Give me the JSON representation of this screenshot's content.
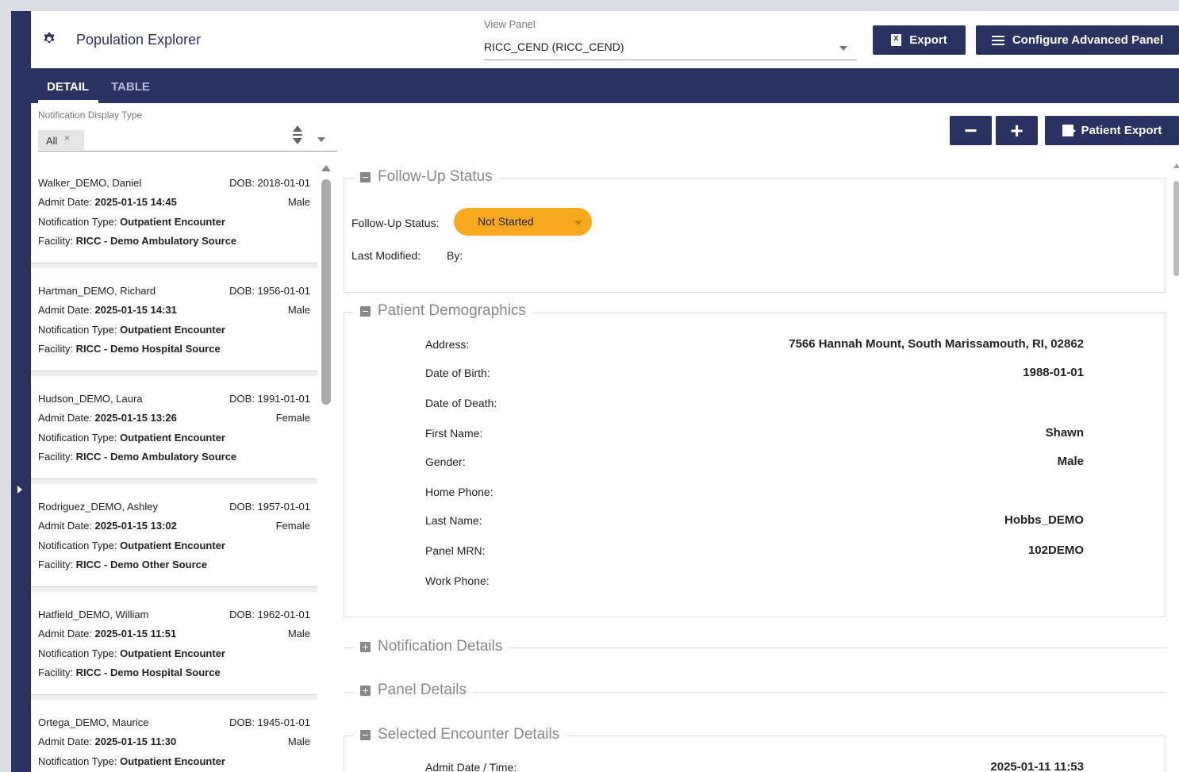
{
  "header": {
    "app_title": "Population Explorer",
    "view_panel_label": "View Panel",
    "view_panel_value": "RICC_CEND (RICC_CEND)",
    "export_label": "Export",
    "configure_label": "Configure Advanced Panel"
  },
  "tabs": [
    {
      "label": "DETAIL",
      "active": true
    },
    {
      "label": "TABLE",
      "active": false
    }
  ],
  "filter": {
    "label": "Notification Display Type",
    "chip": "All",
    "chip_remove": "×"
  },
  "actions": {
    "minus": "−",
    "plus": "+",
    "patient_export": "Patient Export"
  },
  "patients": [
    {
      "name": "Walker_DEMO, Daniel",
      "dob": "DOB: 2018-01-01",
      "admit_label": "Admit Date: ",
      "admit": "2025-01-15 14:45",
      "sex": "Male",
      "ntype_label": "Notification Type: ",
      "ntype": "Outpatient Encounter",
      "facility_label": "Facility: ",
      "facility": "RICC - Demo Ambulatory Source"
    },
    {
      "name": "Hartman_DEMO, Richard",
      "dob": "DOB: 1956-01-01",
      "admit_label": "Admit Date: ",
      "admit": "2025-01-15 14:31",
      "sex": "Male",
      "ntype_label": "Notification Type: ",
      "ntype": "Outpatient Encounter",
      "facility_label": "Facility: ",
      "facility": "RICC - Demo Hospital Source"
    },
    {
      "name": "Hudson_DEMO, Laura",
      "dob": "DOB: 1991-01-01",
      "admit_label": "Admit Date: ",
      "admit": "2025-01-15 13:26",
      "sex": "Female",
      "ntype_label": "Notification Type: ",
      "ntype": "Outpatient Encounter",
      "facility_label": "Facility: ",
      "facility": "RICC - Demo Ambulatory Source"
    },
    {
      "name": "Rodriguez_DEMO, Ashley",
      "dob": "DOB: 1957-01-01",
      "admit_label": "Admit Date: ",
      "admit": "2025-01-15 13:02",
      "sex": "Female",
      "ntype_label": "Notification Type: ",
      "ntype": "Outpatient Encounter",
      "facility_label": "Facility: ",
      "facility": "RICC - Demo Other Source"
    },
    {
      "name": "Hatfield_DEMO, William",
      "dob": "DOB: 1962-01-01",
      "admit_label": "Admit Date: ",
      "admit": "2025-01-15 11:51",
      "sex": "Male",
      "ntype_label": "Notification Type: ",
      "ntype": "Outpatient Encounter",
      "facility_label": "Facility: ",
      "facility": "RICC - Demo Hospital Source"
    },
    {
      "name": "Ortega_DEMO, Maurice",
      "dob": "DOB: 1945-01-01",
      "admit_label": "Admit Date: ",
      "admit": "2025-01-15 11:30",
      "sex": "Male",
      "ntype_label": "Notification Type: ",
      "ntype": "Outpatient Encounter",
      "facility_label": "Facility: ",
      "facility": ""
    }
  ],
  "followup": {
    "title": "Follow-Up Status",
    "status_label": "Follow-Up Status:",
    "status_value": "Not Started",
    "last_modified_label": "Last Modified:",
    "by_label": "By:"
  },
  "demographics": {
    "title": "Patient Demographics",
    "fields": [
      {
        "label": "Address:",
        "value": "7566 Hannah Mount, South Marissamouth, RI, 02862"
      },
      {
        "label": "Date of Birth:",
        "value": "1988-01-01"
      },
      {
        "label": "Date of Death:",
        "value": ""
      },
      {
        "label": "First Name:",
        "value": "Shawn"
      },
      {
        "label": "Gender:",
        "value": "Male"
      },
      {
        "label": "Home Phone:",
        "value": ""
      },
      {
        "label": "Last Name:",
        "value": "Hobbs_DEMO"
      },
      {
        "label": "Panel MRN:",
        "value": "102DEMO"
      },
      {
        "label": "Work Phone:",
        "value": ""
      }
    ]
  },
  "collapsed_sections": {
    "notification_details": "Notification Details",
    "panel_details": "Panel Details"
  },
  "encounter": {
    "title": "Selected Encounter Details",
    "admit_label": "Admit Date / Time:",
    "admit_value": "2025-01-11 11:53"
  },
  "colors": {
    "brand": "#2a3262",
    "status_not_started": "#f7a91e"
  }
}
